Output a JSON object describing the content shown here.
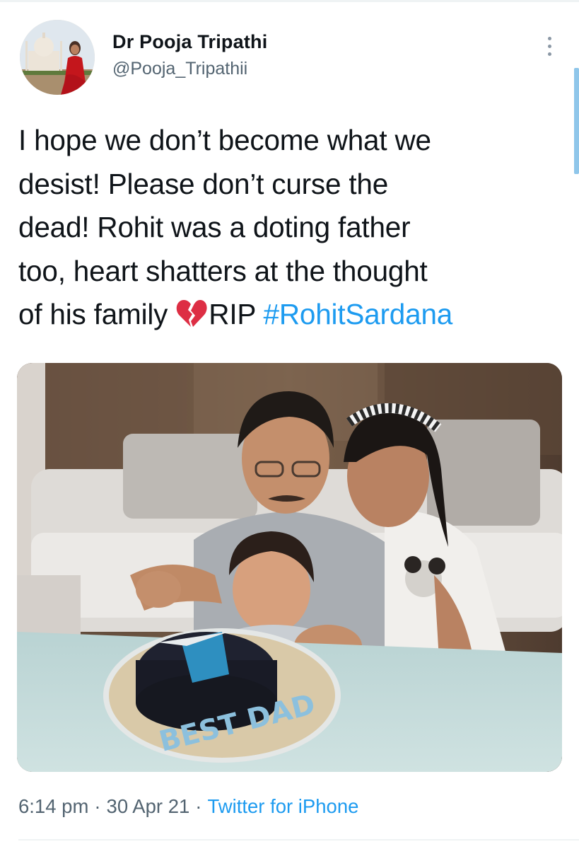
{
  "author": {
    "display_name": "Dr Pooja Tripathi",
    "handle": "@Pooja_Tripathii"
  },
  "tweet": {
    "lines": [
      "I hope we don’t become what we",
      "desist! Please don’t curse the",
      "dead! Rohit was a doting father",
      "too, heart shatters at the thought"
    ],
    "last_line_prefix": "of his family ",
    "emoji": "broken-heart-icon",
    "last_line_suffix": "RIP ",
    "hashtag": "#RohitSardana",
    "hashtag_color": "#1d9bf0"
  },
  "photo": {
    "cake_text": "BEST DAD"
  },
  "meta": {
    "time": "6:14 pm",
    "separator": "·",
    "date": "30 Apr 21",
    "source": "Twitter for iPhone",
    "link_color": "#1d9bf0",
    "muted_color": "#536471"
  },
  "icons": {
    "more": "more-vertical-icon"
  }
}
